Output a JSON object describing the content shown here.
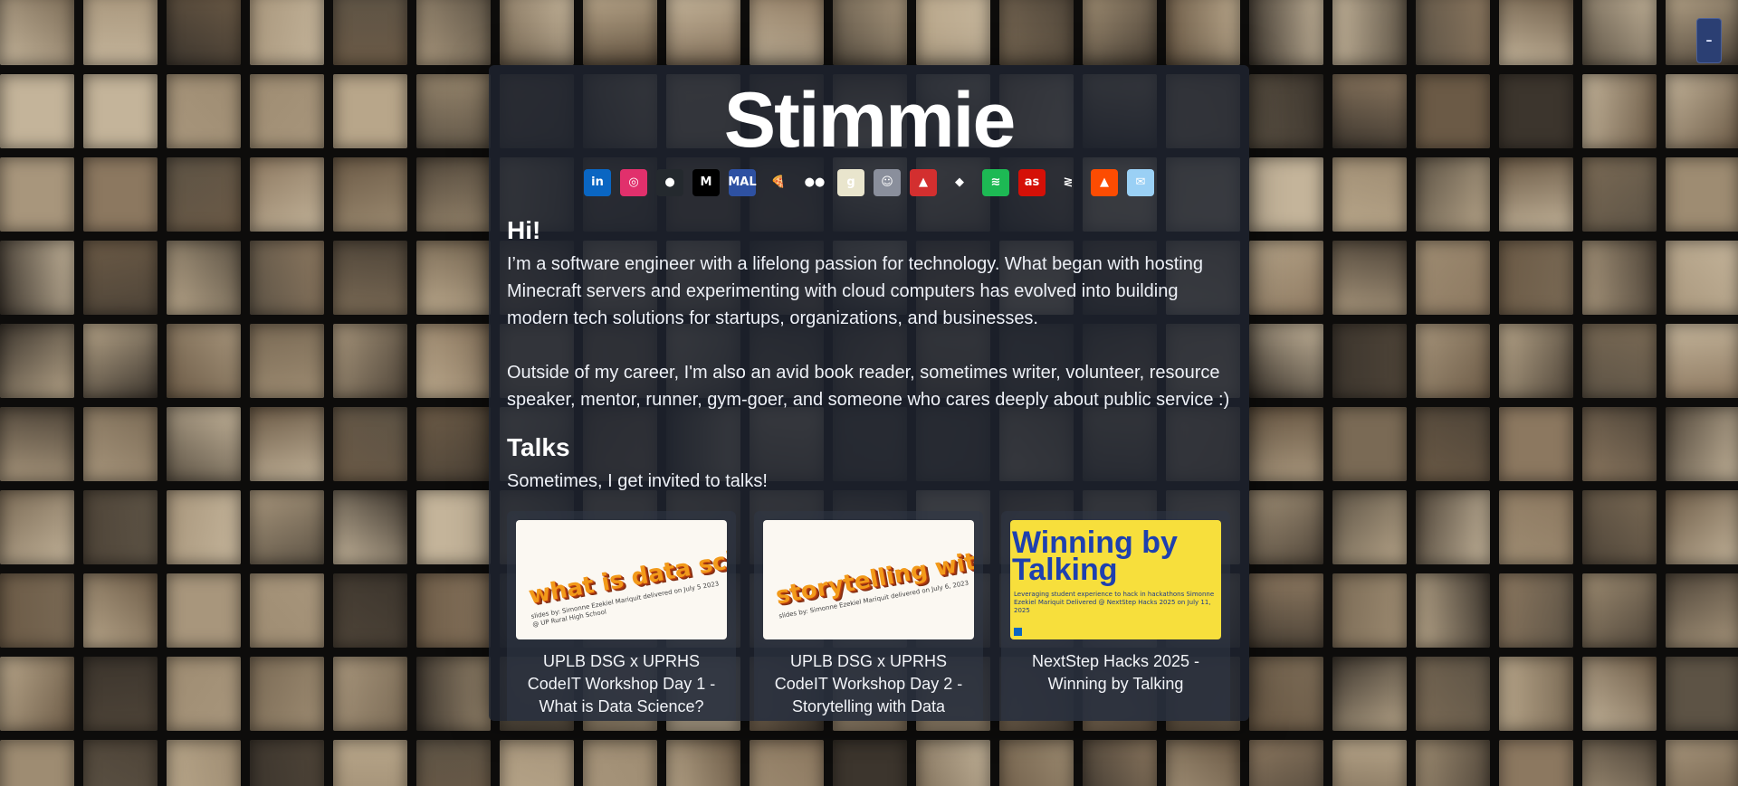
{
  "window": {
    "minimize_label": "–"
  },
  "profile": {
    "name": "Stimmie"
  },
  "socials": [
    {
      "icon": "linkedin-icon",
      "glyph": "in",
      "color": "#0a66c2"
    },
    {
      "icon": "instagram-icon",
      "glyph": "◎",
      "color": "#e1306c"
    },
    {
      "icon": "github-icon",
      "glyph": "●",
      "color": "#24292e"
    },
    {
      "icon": "medium-icon",
      "glyph": "M",
      "color": "#000000"
    },
    {
      "icon": "myanimelist-icon",
      "glyph": "MAL",
      "color": "#2e51a2"
    },
    {
      "icon": "pizza-icon",
      "glyph": "🍕",
      "color": "transparent"
    },
    {
      "icon": "flickr-icon",
      "glyph": "●●",
      "color": "transparent"
    },
    {
      "icon": "goodreads-icon",
      "glyph": "g",
      "color": "#e9e5cd"
    },
    {
      "icon": "avatar-icon",
      "glyph": "☺",
      "color": "#8a8f9c"
    },
    {
      "icon": "backpack-icon",
      "glyph": "▲",
      "color": "#d32f2f"
    },
    {
      "icon": "gitlab-icon",
      "glyph": "◆",
      "color": "transparent"
    },
    {
      "icon": "spotify-icon",
      "glyph": "≋",
      "color": "#1db954"
    },
    {
      "icon": "lastfm-icon",
      "glyph": "as",
      "color": "#d51007"
    },
    {
      "icon": "codewars-icon",
      "glyph": "≷",
      "color": "transparent"
    },
    {
      "icon": "strava-icon",
      "glyph": "▲",
      "color": "#fc4c02"
    },
    {
      "icon": "email-icon",
      "glyph": "✉",
      "color": "#9ad0f5"
    }
  ],
  "intro": {
    "heading": "Hi!",
    "para1": "I’m a software engineer with a lifelong passion for technology. What began with hosting Minecraft servers and experimenting with cloud computers has evolved into building modern tech solutions for startups, organizations, and businesses.",
    "para2": "Outside of my career, I'm also an avid book reader, sometimes writer, volunteer, resource speaker, mentor, runner, gym-goer, and someone who cares deeply about public service :)"
  },
  "talks": {
    "heading": "Talks",
    "subheading": "Sometimes, I get invited to talks!",
    "items": [
      {
        "title": "UPLB DSG x UPRHS CodeIT Workshop Day 1 - What is Data Science?",
        "thumb_text": "what is data science?",
        "thumb_small": "slides by: Simonne Ezekiel Mariquit\ndelivered on July 5 2023 @ UP Rural High School"
      },
      {
        "title": "UPLB DSG x UPRHS CodeIT Workshop Day 2 - Storytelling with Data",
        "thumb_text": "storytelling with data",
        "thumb_small": "slides by: Simonne Ezekiel Mariquit\ndelivered on July 6, 2023"
      },
      {
        "title": "NextStep Hacks 2025 - Winning by Talking",
        "thumb_text": "Winning by Talking",
        "thumb_small": "Leveraging student experience to hack in hackathons\nSimonne Ezekiel Mariquit\nDelivered @ NextStep Hacks 2025 on July 11, 2025"
      }
    ]
  }
}
